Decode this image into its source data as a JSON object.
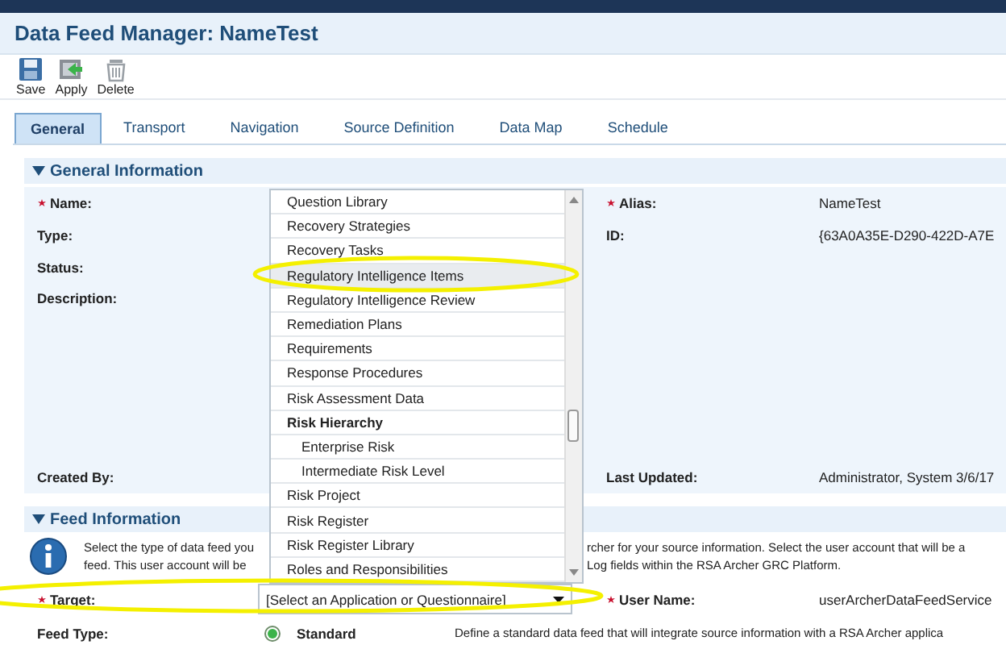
{
  "window": {
    "title": "Data Feed Manager: NameTest"
  },
  "toolbar": [
    {
      "label": "Save"
    },
    {
      "label": "Apply"
    },
    {
      "label": "Delete"
    }
  ],
  "tabs": [
    {
      "label": "General",
      "selected": true
    },
    {
      "label": "Transport",
      "selected": false
    },
    {
      "label": "Navigation",
      "selected": false
    },
    {
      "label": "Source Definition",
      "selected": false
    },
    {
      "label": "Data Map",
      "selected": false
    },
    {
      "label": "Schedule",
      "selected": false
    }
  ],
  "general_information": {
    "title": "General Information",
    "expanded": true,
    "left_fields": [
      {
        "label": "Name:",
        "required": true
      },
      {
        "label": "Type:",
        "required": false
      },
      {
        "label": "Status:",
        "required": false
      },
      {
        "label": "Description:",
        "required": false
      },
      {
        "label": "Created By:",
        "required": false
      }
    ],
    "right_fields": [
      {
        "label": "Alias:",
        "required": true,
        "value": "NameTest"
      },
      {
        "label": "ID:",
        "required": false,
        "value": "{63A0A35E-D290-422D-A7E"
      },
      {
        "label": "Last Updated:",
        "required": false,
        "value": "Administrator, System  3/6/17"
      }
    ]
  },
  "feed_information": {
    "title": "Feed Information",
    "expanded": true,
    "info_text_left": [
      "Select the type of data feed you",
      "feed. This user account will be"
    ],
    "info_text_right": [
      "rcher for your source information. Select the user account that will be a",
      "Log fields within the RSA Archer GRC Platform."
    ],
    "target": {
      "label": "Target:",
      "required": true,
      "value": "[Select an Application or Questionnaire]",
      "expanded": true
    },
    "user_name": {
      "label": "User Name:",
      "required": true,
      "value": "userArcherDataFeedService"
    },
    "feed_type": {
      "label": "Feed Type:",
      "options": [
        {
          "label": "Standard",
          "selected": true,
          "description": "Define a standard data feed that will integrate source information with a RSA Archer applica"
        }
      ]
    }
  },
  "dropdown_options": [
    {
      "label": "Question Library",
      "selected": false
    },
    {
      "label": "Recovery Strategies",
      "selected": false
    },
    {
      "label": "Recovery Tasks",
      "selected": false
    },
    {
      "label": "Regulatory Intelligence Items",
      "selected": true
    },
    {
      "label": "Regulatory Intelligence Review",
      "selected": false
    },
    {
      "label": "Remediation Plans",
      "selected": false
    },
    {
      "label": "Requirements",
      "selected": false
    },
    {
      "label": "Response Procedures",
      "selected": false
    },
    {
      "label": "Risk Assessment Data",
      "selected": false
    },
    {
      "label": "Risk Hierarchy",
      "selected": false,
      "children": [
        {
          "label": "Enterprise Risk",
          "selected": false
        },
        {
          "label": "Intermediate Risk Level",
          "selected": false
        }
      ]
    },
    {
      "label": "Risk Project",
      "selected": false
    },
    {
      "label": "Risk Register",
      "selected": false
    },
    {
      "label": "Risk Register Library",
      "selected": false
    },
    {
      "label": "Roles and Responsibilities",
      "selected": false
    }
  ]
}
